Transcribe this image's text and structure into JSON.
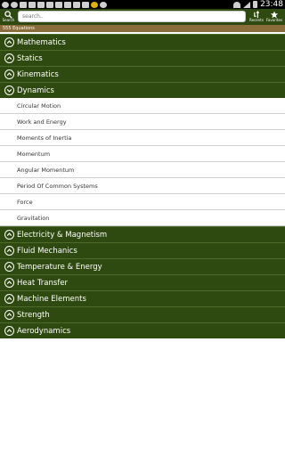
{
  "status_bar": {
    "time": "23:48"
  },
  "toolbar": {
    "search_caption": "Search",
    "search_placeholder": "search..",
    "recents_caption": "Recents",
    "favorites_caption": "Favorites"
  },
  "equation_count": "555 Equations",
  "categories": [
    {
      "label": "Mathematics",
      "expanded": false
    },
    {
      "label": "Statics",
      "expanded": false
    },
    {
      "label": "Kinematics",
      "expanded": false
    },
    {
      "label": "Dynamics",
      "expanded": true,
      "items": [
        "Circular Motion",
        "Work and Energy",
        "Moments of Inertia",
        "Momentum",
        "Angular Momentum",
        "Period Of Common Systems",
        "Force",
        "Gravitation"
      ]
    },
    {
      "label": "Electricity & Magnetism",
      "expanded": false
    },
    {
      "label": "Fluid Mechanics",
      "expanded": false
    },
    {
      "label": "Temperature & Energy",
      "expanded": false
    },
    {
      "label": "Heat Transfer",
      "expanded": false
    },
    {
      "label": "Machine Elements",
      "expanded": false
    },
    {
      "label": "Strength",
      "expanded": false
    },
    {
      "label": "Aerodynamics",
      "expanded": false
    }
  ],
  "colors": {
    "header_green": "#2f4a10",
    "count_bar_brown": "#8a6d3b"
  }
}
